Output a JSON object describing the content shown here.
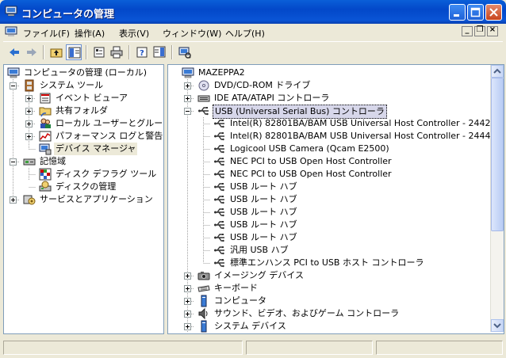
{
  "window": {
    "title": "コンピュータの管理",
    "icon": "computer-management-icon"
  },
  "menu": {
    "items": [
      {
        "label": "ファイル(F)"
      },
      {
        "label": "操作(A)"
      },
      {
        "label": "表示(V)"
      },
      {
        "label": "ウィンドウ(W)"
      },
      {
        "label": "ヘルプ(H)"
      }
    ]
  },
  "toolbar": {
    "buttons": [
      "back-arrow-icon",
      "forward-arrow-icon",
      "up-folder-icon",
      "show-hide-tree-icon",
      "properties-icon",
      "print-icon",
      "help-icon",
      "show-hide-action-pane-icon",
      "scan-hardware-icon"
    ]
  },
  "tree": {
    "root": "コンピュータの管理 (ローカル)",
    "items": [
      {
        "label": "システム ツール"
      },
      {
        "label": "イベント ビューア"
      },
      {
        "label": "共有フォルダ"
      },
      {
        "label": "ローカル ユーザーとグループ"
      },
      {
        "label": "パフォーマンス ログと警告"
      },
      {
        "label": "デバイス マネージャ"
      },
      {
        "label": "記憶域"
      },
      {
        "label": "ディスク デフラグ ツール"
      },
      {
        "label": "ディスクの管理"
      },
      {
        "label": "サービスとアプリケーション"
      }
    ]
  },
  "devices": {
    "computer": "MAZEPPA2",
    "items": [
      {
        "label": "DVD/CD-ROM ドライブ"
      },
      {
        "label": "IDE ATA/ATAPI コントローラ"
      },
      {
        "label": "USB (Universal Serial Bus) コントローラ"
      },
      {
        "label": "Intel(R) 82801BA/BAM USB Universal Host Controller - 2442"
      },
      {
        "label": "Intel(R) 82801BA/BAM USB Universal Host Controller - 2444"
      },
      {
        "label": "Logicool USB Camera (Qcam E2500)"
      },
      {
        "label": "NEC PCI to USB Open Host Controller"
      },
      {
        "label": "NEC PCI to USB Open Host Controller"
      },
      {
        "label": "USB ルート ハブ"
      },
      {
        "label": "USB ルート ハブ"
      },
      {
        "label": "USB ルート ハブ"
      },
      {
        "label": "USB ルート ハブ"
      },
      {
        "label": "USB ルート ハブ"
      },
      {
        "label": "汎用 USB ハブ"
      },
      {
        "label": "標準エンハンス PCI to USB ホスト コントローラ"
      },
      {
        "label": "イメージング デバイス"
      },
      {
        "label": "キーボード"
      },
      {
        "label": "コンピュータ"
      },
      {
        "label": "サウンド、ビデオ、およびゲーム コントローラ"
      },
      {
        "label": "システム デバイス"
      }
    ]
  },
  "colors": {
    "titlebar": "#0a55d6",
    "selection": "#d7d7ea"
  }
}
